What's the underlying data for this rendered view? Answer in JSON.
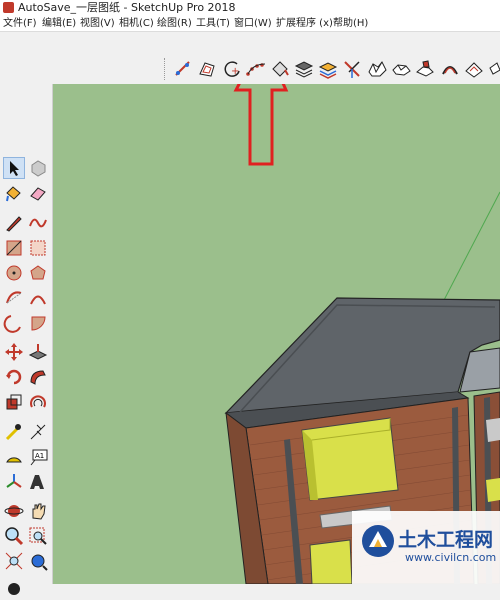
{
  "window": {
    "title": "AutoSave_一层图纸 - SketchUp Pro 2018"
  },
  "menu": {
    "items": [
      "文件(F)",
      "编辑(E)",
      "视图(V)",
      "相机(C)",
      "绘图(R)",
      "工具(T)",
      "窗口(W)",
      "扩展程序 (x)",
      "帮助(H)"
    ]
  },
  "toolbar_top": {
    "icons": [
      "follow-me-icon",
      "offset-icon",
      "circle-icon",
      "arc-icon",
      "paint-bucket-icon",
      "layers-icon",
      "outliner-icon",
      "axes-icon",
      "sandbox-icon",
      "smoove-icon",
      "stamp-icon",
      "drape-icon",
      "add-detail-icon",
      "flip-edge-icon"
    ]
  },
  "toolbar_left": {
    "icons": [
      "select-icon",
      "component-icon",
      "paint-bucket-icon",
      "eraser-icon",
      "pencil-icon",
      "freehand-icon",
      "rectangle-icon",
      "rotated-rectangle-icon",
      "circle-icon",
      "polygon-icon",
      "arc-icon",
      "two-point-arc-icon",
      "three-point-arc-icon",
      "pie-icon",
      "move-icon",
      "push-pull-icon",
      "rotate-icon",
      "follow-me-icon",
      "scale-icon",
      "offset-icon",
      "tape-measure-icon",
      "dimension-icon",
      "protractor-icon",
      "text-icon",
      "axes-icon",
      "3d-text-icon",
      "orbit-icon",
      "pan-icon",
      "zoom-icon",
      "zoom-window-icon",
      "zoom-extents-icon",
      "walk-icon"
    ]
  },
  "watermark": {
    "text": "土木工程网",
    "url": "www.civilcn.com"
  },
  "colors": {
    "ground": "#9bbf8c",
    "roof": "#5f6469",
    "brick": "#9b5b3e",
    "window_yellow": "#d9e04a",
    "arrow": "#e02020"
  }
}
